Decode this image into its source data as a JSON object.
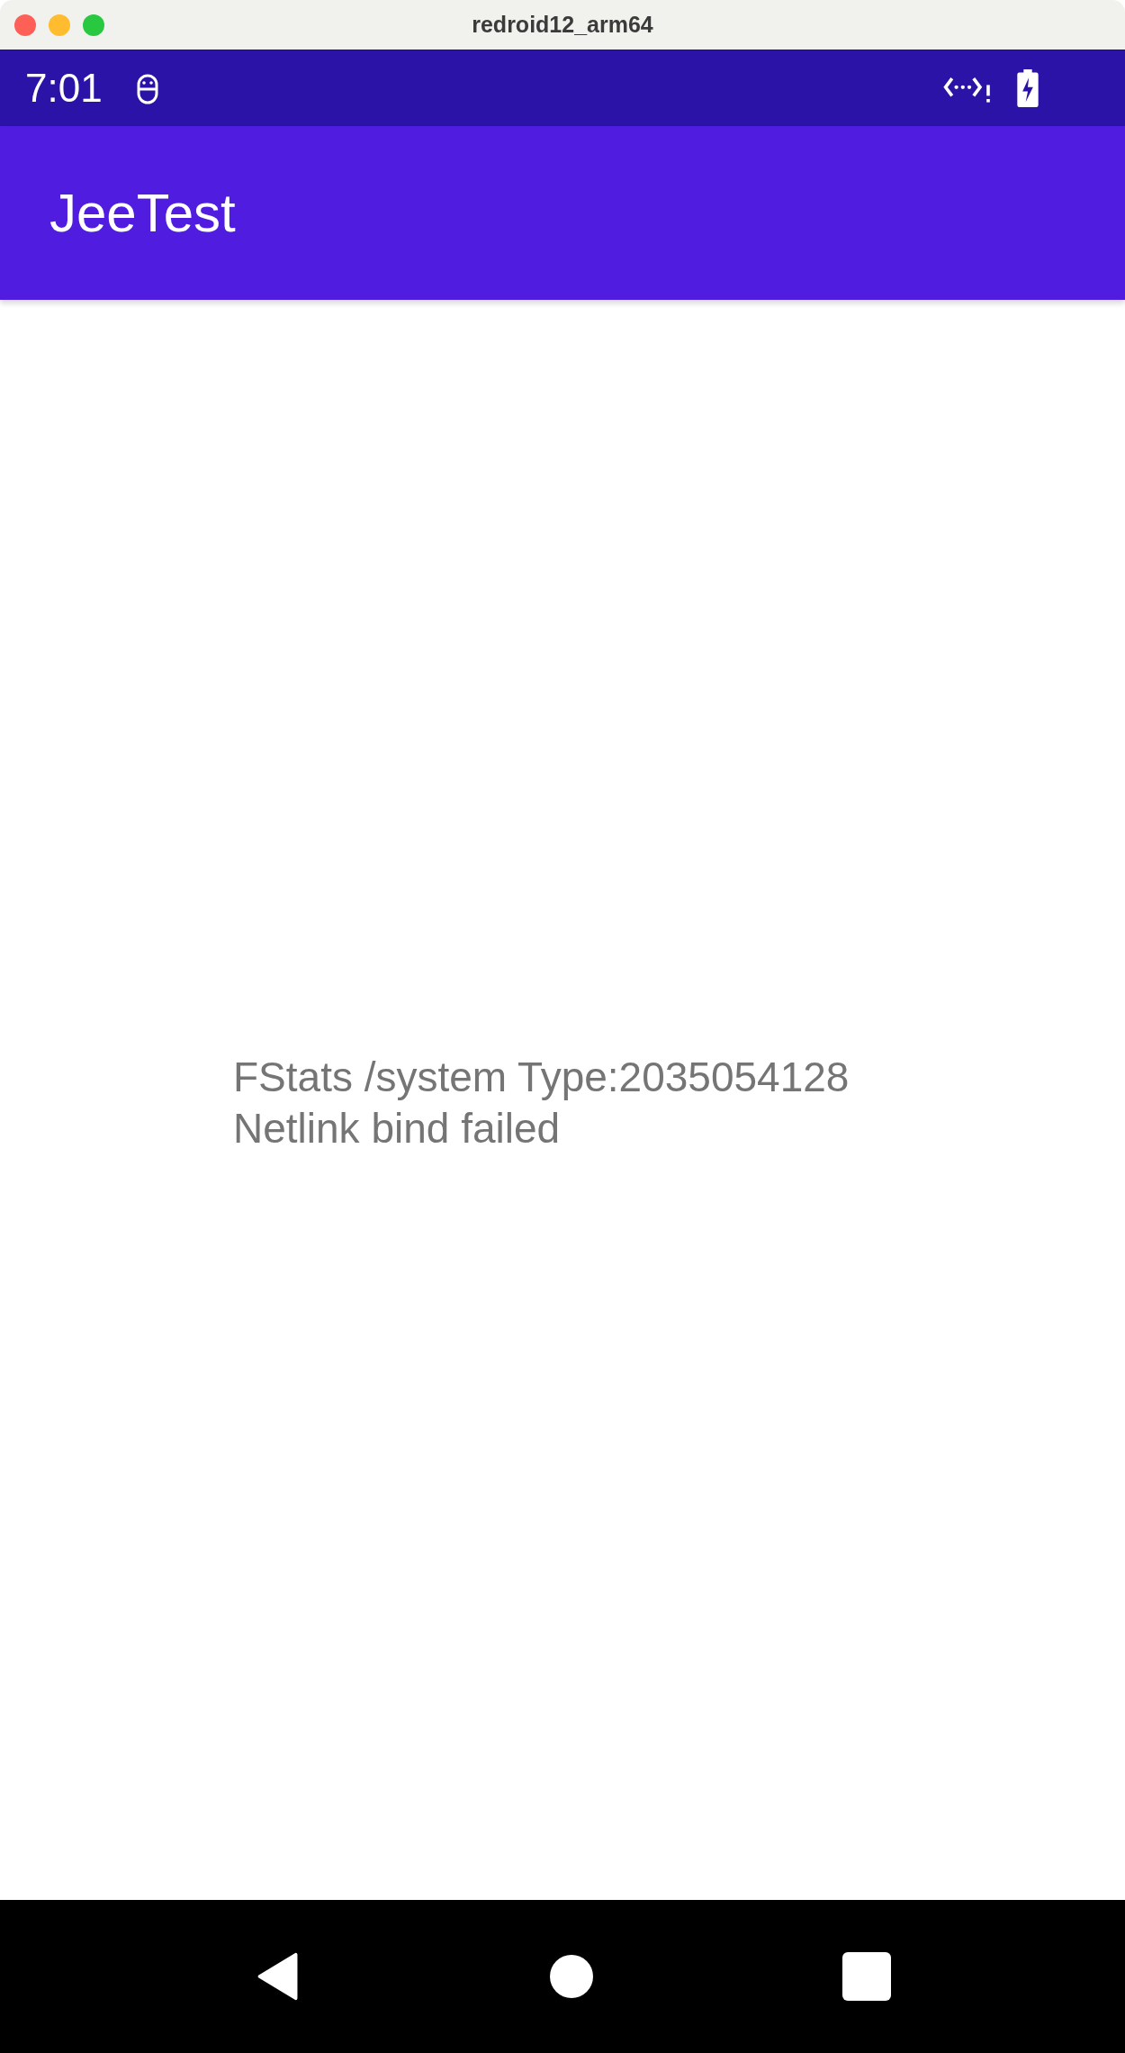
{
  "window": {
    "title": "redroid12_arm64"
  },
  "status_bar": {
    "time": "7:01"
  },
  "app_bar": {
    "title": "JeeTest"
  },
  "content": {
    "lines": [
      "FStats /system Type:2035054128",
      "Netlink bind failed"
    ]
  }
}
